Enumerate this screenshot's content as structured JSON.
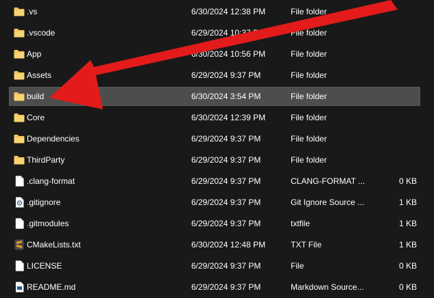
{
  "rows": [
    {
      "name": ".vs",
      "date": "6/30/2024 12:38 PM",
      "type": "File folder",
      "size": "",
      "icon": "folder-icon"
    },
    {
      "name": ".vscode",
      "date": "6/29/2024 10:37 PM",
      "type": "File folder",
      "size": "",
      "icon": "folder-icon"
    },
    {
      "name": "App",
      "date": "6/30/2024 10:56 PM",
      "type": "File folder",
      "size": "",
      "icon": "folder-icon"
    },
    {
      "name": "Assets",
      "date": "6/29/2024 9:37 PM",
      "type": "File folder",
      "size": "",
      "icon": "folder-icon"
    },
    {
      "name": "build",
      "date": "6/30/2024 3:54 PM",
      "type": "File folder",
      "size": "",
      "icon": "folder-icon",
      "selected": true
    },
    {
      "name": "Core",
      "date": "6/30/2024 12:39 PM",
      "type": "File folder",
      "size": "",
      "icon": "folder-icon"
    },
    {
      "name": "Dependencies",
      "date": "6/29/2024 9:37 PM",
      "type": "File folder",
      "size": "",
      "icon": "folder-icon"
    },
    {
      "name": "ThirdParty",
      "date": "6/29/2024 9:37 PM",
      "type": "File folder",
      "size": "",
      "icon": "folder-icon"
    },
    {
      "name": ".clang-format",
      "date": "6/29/2024 9:37 PM",
      "type": "CLANG-FORMAT ...",
      "size": "0 KB",
      "icon": "file-icon"
    },
    {
      "name": ".gitignore",
      "date": "6/29/2024 9:37 PM",
      "type": "Git Ignore Source ...",
      "size": "1 KB",
      "icon": "gear-file-icon"
    },
    {
      "name": ".gitmodules",
      "date": "6/29/2024 9:37 PM",
      "type": "txtfile",
      "size": "1 KB",
      "icon": "file-icon"
    },
    {
      "name": "CMakeLists.txt",
      "date": "6/30/2024 12:48 PM",
      "type": "TXT File",
      "size": "1 KB",
      "icon": "sublime-file-icon"
    },
    {
      "name": "LICENSE",
      "date": "6/29/2024 9:37 PM",
      "type": "File",
      "size": "0 KB",
      "icon": "file-icon"
    },
    {
      "name": "README.md",
      "date": "6/29/2024 9:37 PM",
      "type": "Markdown Source...",
      "size": "0 KB",
      "icon": "markdown-file-icon"
    }
  ],
  "colors": {
    "background": "#191919",
    "selected_row": "#4d4d4d",
    "folder": "#f2c55c",
    "arrow": "#e31b1b"
  }
}
